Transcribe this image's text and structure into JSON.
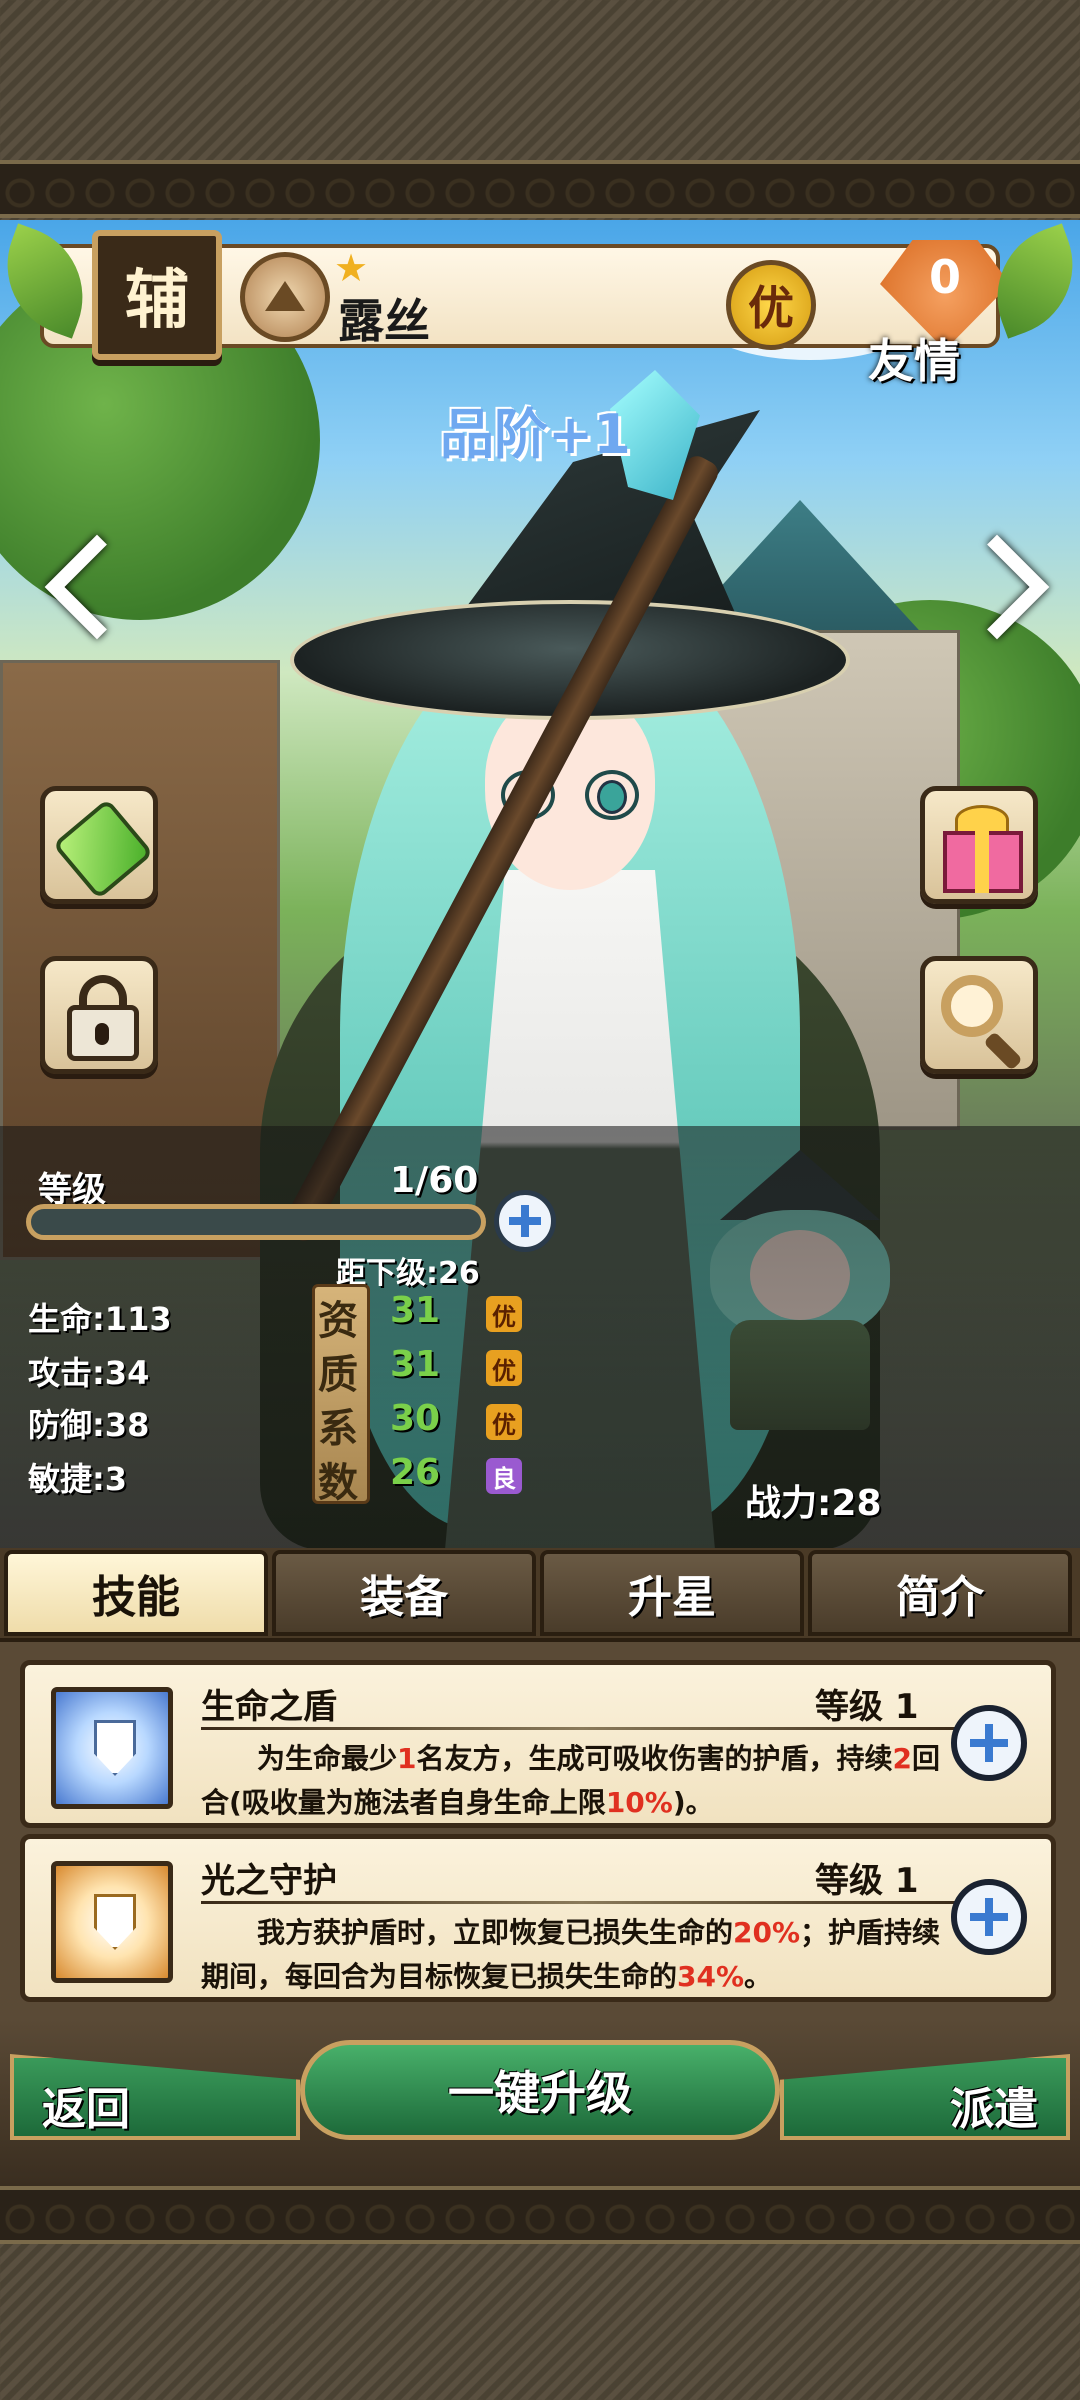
{
  "header": {
    "role_badge": "辅",
    "character_name": "露丝",
    "quality_badge": "优",
    "friendship_value": "0",
    "friendship_label": "友情",
    "element_icon": "mountain-icon",
    "star_icon": "star-icon"
  },
  "grade_title": "品阶+1",
  "side_buttons": {
    "left": [
      "potion-icon",
      "lock-icon"
    ],
    "right": [
      "gift-icon",
      "magnifier-icon"
    ]
  },
  "level": {
    "label": "等级",
    "value": "1/60",
    "progress": 0,
    "next_level": "距下级:26"
  },
  "stats": {
    "hp": "生命:113",
    "atk": "攻击:34",
    "def": "防御:38",
    "spd": "敏捷:3"
  },
  "aptitude": {
    "chars": [
      "资",
      "质",
      "系",
      "数"
    ],
    "rows": [
      {
        "value": "31",
        "grade": "优"
      },
      {
        "value": "31",
        "grade": "优"
      },
      {
        "value": "30",
        "grade": "优"
      },
      {
        "value": "26",
        "grade": "良"
      }
    ]
  },
  "battle_power": "战力:28",
  "tabs": [
    "技能",
    "装备",
    "升星",
    "简介"
  ],
  "active_tab": "技能",
  "skills": [
    {
      "name": "生命之盾",
      "level": "等级 1",
      "desc_parts": [
        "为生命最少",
        "1",
        "名友方，生成可吸收伤害的护盾，持续",
        "2",
        "回合(吸收量为施法者自身生命上限",
        "10%",
        ")。"
      ]
    },
    {
      "name": "光之守护",
      "level": "等级 1",
      "desc_parts": [
        "我方获护盾时，立即恢复已损失生命的",
        "20%",
        "；护盾持续期间，每回合为目标恢复已损失生命的",
        "34%",
        "。"
      ]
    }
  ],
  "actions": {
    "back": "返回",
    "upgrade": "一键升级",
    "dispatch": "派遣"
  },
  "colors": {
    "highlight": "#e03020",
    "aptitude_value": "#7ad04a",
    "grade_title": "#6fa8f0"
  }
}
